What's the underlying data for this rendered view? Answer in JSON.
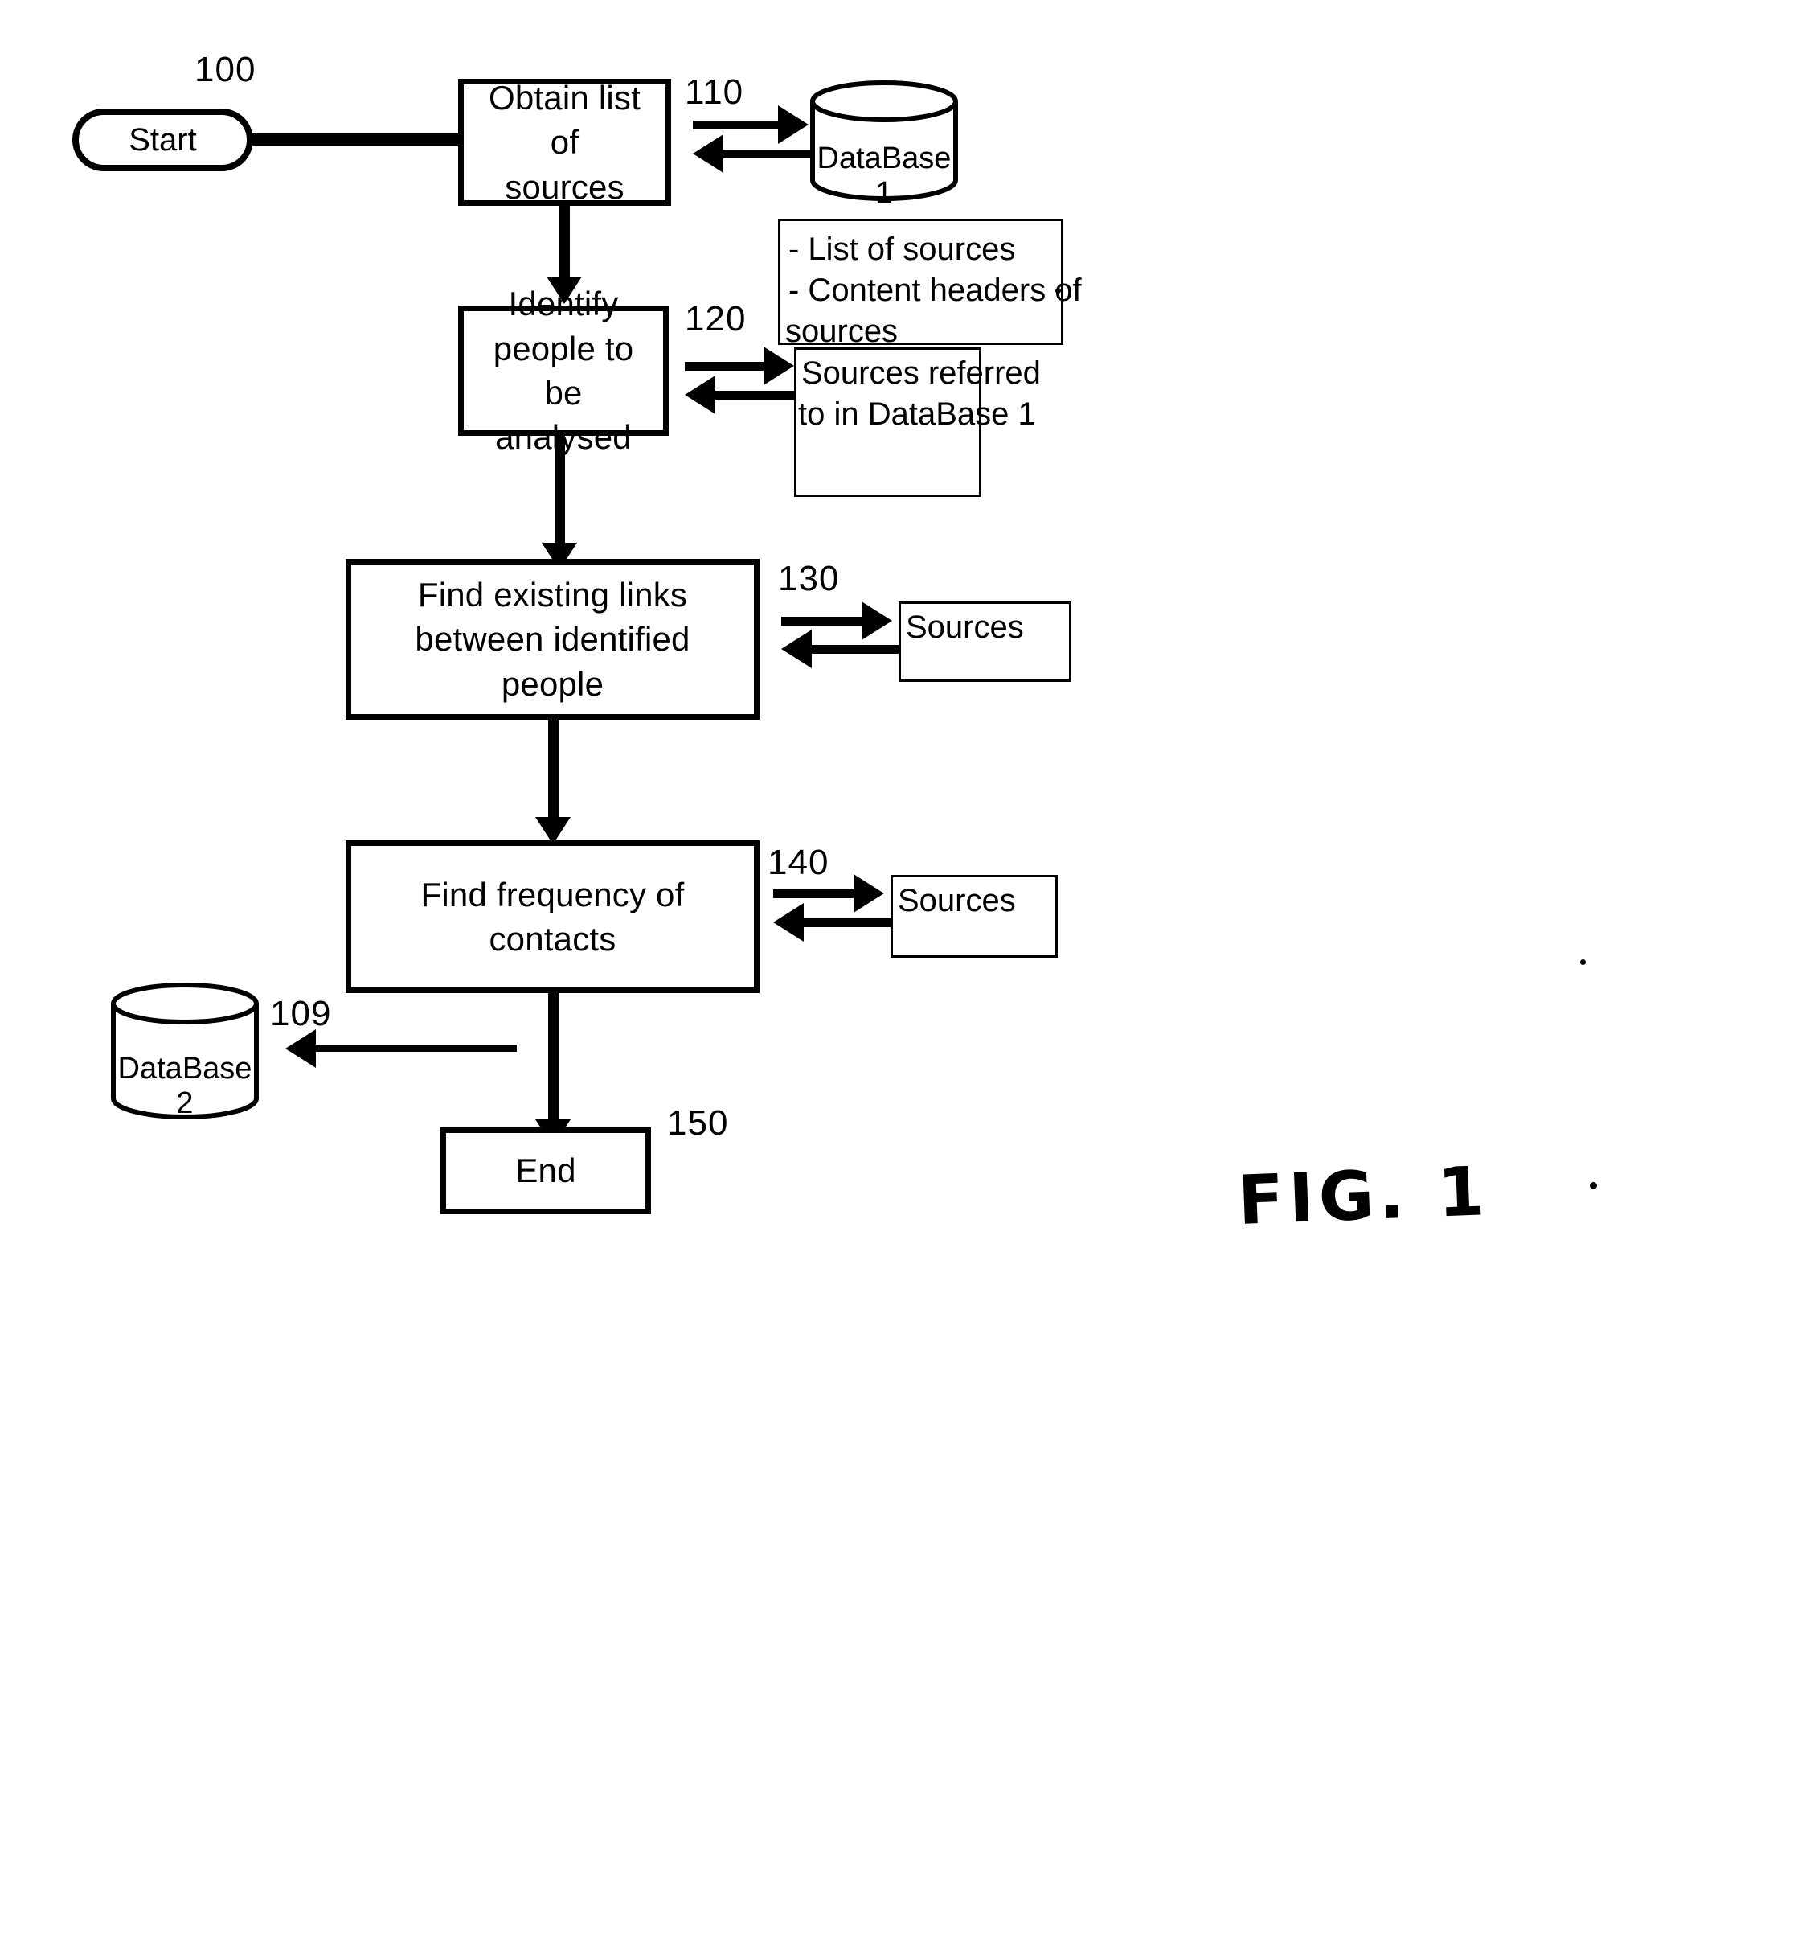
{
  "figure": {
    "caption": "FIG. 1",
    "diagram_ref": "100"
  },
  "nodes": {
    "start": {
      "label": "Start",
      "ref": "100"
    },
    "step_110": {
      "label": "Obtain list of\nsources",
      "ref": "110"
    },
    "step_120": {
      "label": "Identify people to\nbe analysed",
      "ref": "120"
    },
    "step_130": {
      "label": "Find existing links between identified\npeople",
      "ref": "130"
    },
    "step_140": {
      "label": "Find frequency of contacts",
      "ref": "140"
    },
    "end": {
      "label": "End",
      "ref": "150"
    }
  },
  "datastores": {
    "database_1": {
      "label": "DataBase 1"
    },
    "database_2": {
      "label": "DataBase 2",
      "ref": "109"
    }
  },
  "annotations": {
    "db1_contents": {
      "line_1": "- List of sources",
      "line_2": "- Content headers of",
      "line_3": "sources"
    },
    "sources_referred": {
      "line_1": "Sources referred",
      "line_2": "to in DataBase 1"
    },
    "sources_130": {
      "label": "Sources"
    },
    "sources_140": {
      "label": "Sources"
    }
  },
  "colors": {
    "ink": "#000000",
    "paper": "#ffffff"
  }
}
